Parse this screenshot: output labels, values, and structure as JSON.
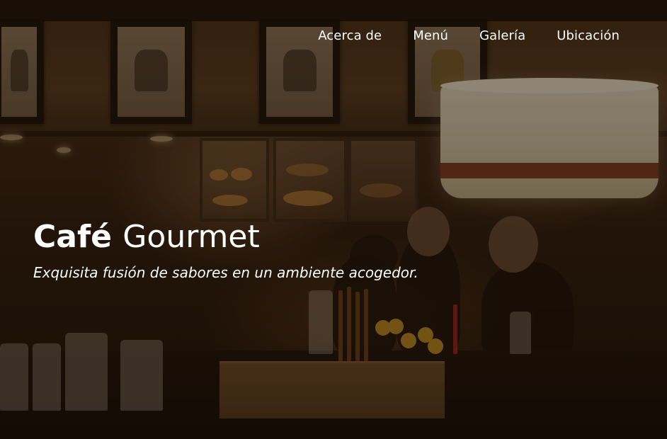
{
  "nav": {
    "links": [
      {
        "label": "Acerca de"
      },
      {
        "label": "Menú"
      },
      {
        "label": "Galería"
      },
      {
        "label": "Ubicación"
      }
    ]
  },
  "hero": {
    "title_bold": "Café",
    "title_light": "Gourmet",
    "tagline": "Exquisita fusión de sabores en un ambiente acogedor.",
    "background_image": "cafe-interior-photo"
  },
  "colors": {
    "text": "#ffffff",
    "overlay": "#140a02",
    "background": "#2d1c0e"
  }
}
